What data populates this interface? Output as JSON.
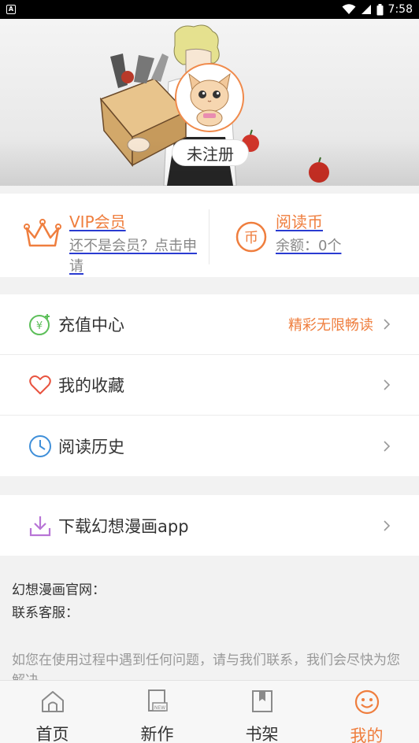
{
  "status_bar": {
    "time": "7:58",
    "app_icon_glyph": "A"
  },
  "profile": {
    "register_label": "未注册"
  },
  "membership": {
    "vip_title": "VIP会员",
    "vip_subtitle": "还不是会员？点击申请",
    "coins_title": "阅读币",
    "coins_balance": "余额：0个"
  },
  "menu": {
    "items": [
      {
        "label": "充值中心",
        "hint": "精彩无限畅读",
        "icon": "recharge-icon"
      },
      {
        "label": "我的收藏",
        "hint": "",
        "icon": "heart-icon"
      },
      {
        "label": "阅读历史",
        "hint": "",
        "icon": "clock-icon"
      }
    ],
    "download": {
      "label": "下载幻想漫画app",
      "icon": "download-icon"
    }
  },
  "info": {
    "website_label": "幻想漫画官网：",
    "service_label": "联系客服：",
    "note": "如您在使用过程中遇到任何问题，请与我们联系，我们会尽快为您解决。"
  },
  "tabs": [
    {
      "label": "首页",
      "icon": "home-icon",
      "active": false
    },
    {
      "label": "新作",
      "icon": "new-icon",
      "active": false
    },
    {
      "label": "书架",
      "icon": "bookshelf-icon",
      "active": false
    },
    {
      "label": "我的",
      "icon": "smile-icon",
      "active": true
    }
  ],
  "colors": {
    "accent": "#ef7e3e",
    "link_underline": "#2a3bd1",
    "background": "#f2f2f2"
  }
}
